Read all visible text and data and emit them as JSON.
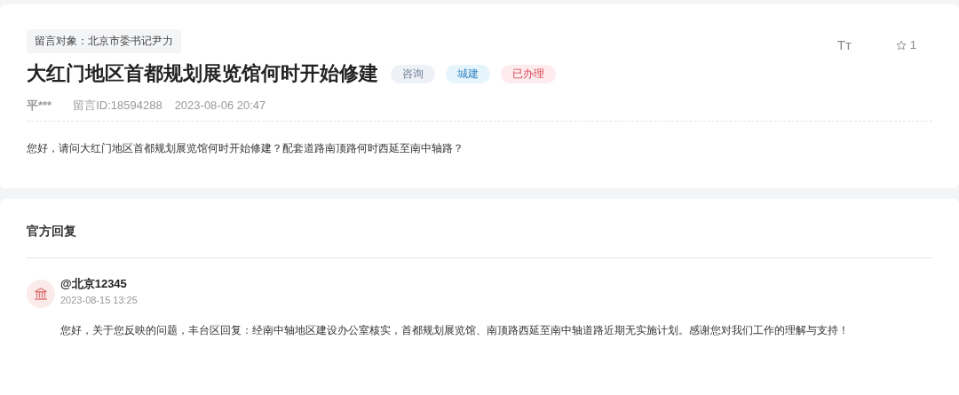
{
  "message": {
    "target": "留言对象：北京市委书记尹力",
    "title": "大红门地区首都规划展览馆何时开始修建",
    "tags": [
      {
        "label": "咨询",
        "kind": "type",
        "color": "#eef2f7"
      },
      {
        "label": "城建",
        "kind": "category",
        "color": "#e6f4fb"
      },
      {
        "label": "已办理",
        "kind": "status",
        "color": "#fdebee"
      }
    ],
    "font_toggle": "Tт",
    "star_count": "1",
    "author": "平***",
    "message_id": "留言ID:18594288",
    "time": "2023-08-06 20:47",
    "body": "您好，请问大红门地区首都规划展览馆何时开始修建？配套道路南顶路何时西延至南中轴路？"
  },
  "reply": {
    "heading": "官方回复",
    "name": "@北京12345",
    "time": "2023-08-15 13:25",
    "body": "您好，关于您反映的问题，丰台区回复：经南中轴地区建设办公室核实，首都规划展览馆、南顶路西延至南中轴道路近期无实施计划。感谢您对我们工作的理解与支持！"
  }
}
